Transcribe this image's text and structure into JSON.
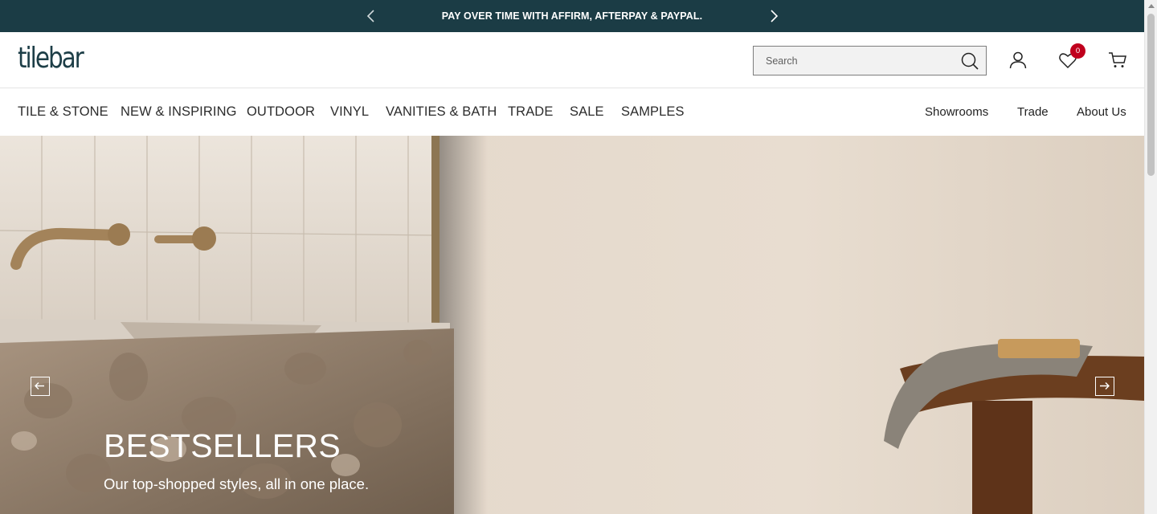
{
  "promo": {
    "text": "PAY OVER TIME WITH AFFIRM, AFTERPAY & PAYPAL.",
    "prev_icon": "chevron-left-icon",
    "next_icon": "chevron-right-icon",
    "background": "#1b3c45"
  },
  "header": {
    "logo": "tilebar",
    "search_placeholder": "Search",
    "search_value": "",
    "wishlist_count": "0",
    "icons": [
      "search-icon",
      "user-icon",
      "heart-icon",
      "cart-icon"
    ],
    "brand_color": "#1d3e47",
    "badge_color": "#c0001d"
  },
  "nav": {
    "main": [
      "TILE & STONE",
      "NEW & INSPIRING",
      "OUTDOOR",
      "VINYL",
      "VANITIES & BATH",
      "TRADE",
      "SALE",
      "SAMPLES"
    ],
    "secondary": [
      "Showrooms",
      "Trade",
      "About Us"
    ]
  },
  "hero": {
    "title": "BESTSELLERS",
    "subtitle": "Our top-shopped styles, all in one place.",
    "prev_icon": "arrow-left-icon",
    "next_icon": "arrow-right-icon"
  }
}
